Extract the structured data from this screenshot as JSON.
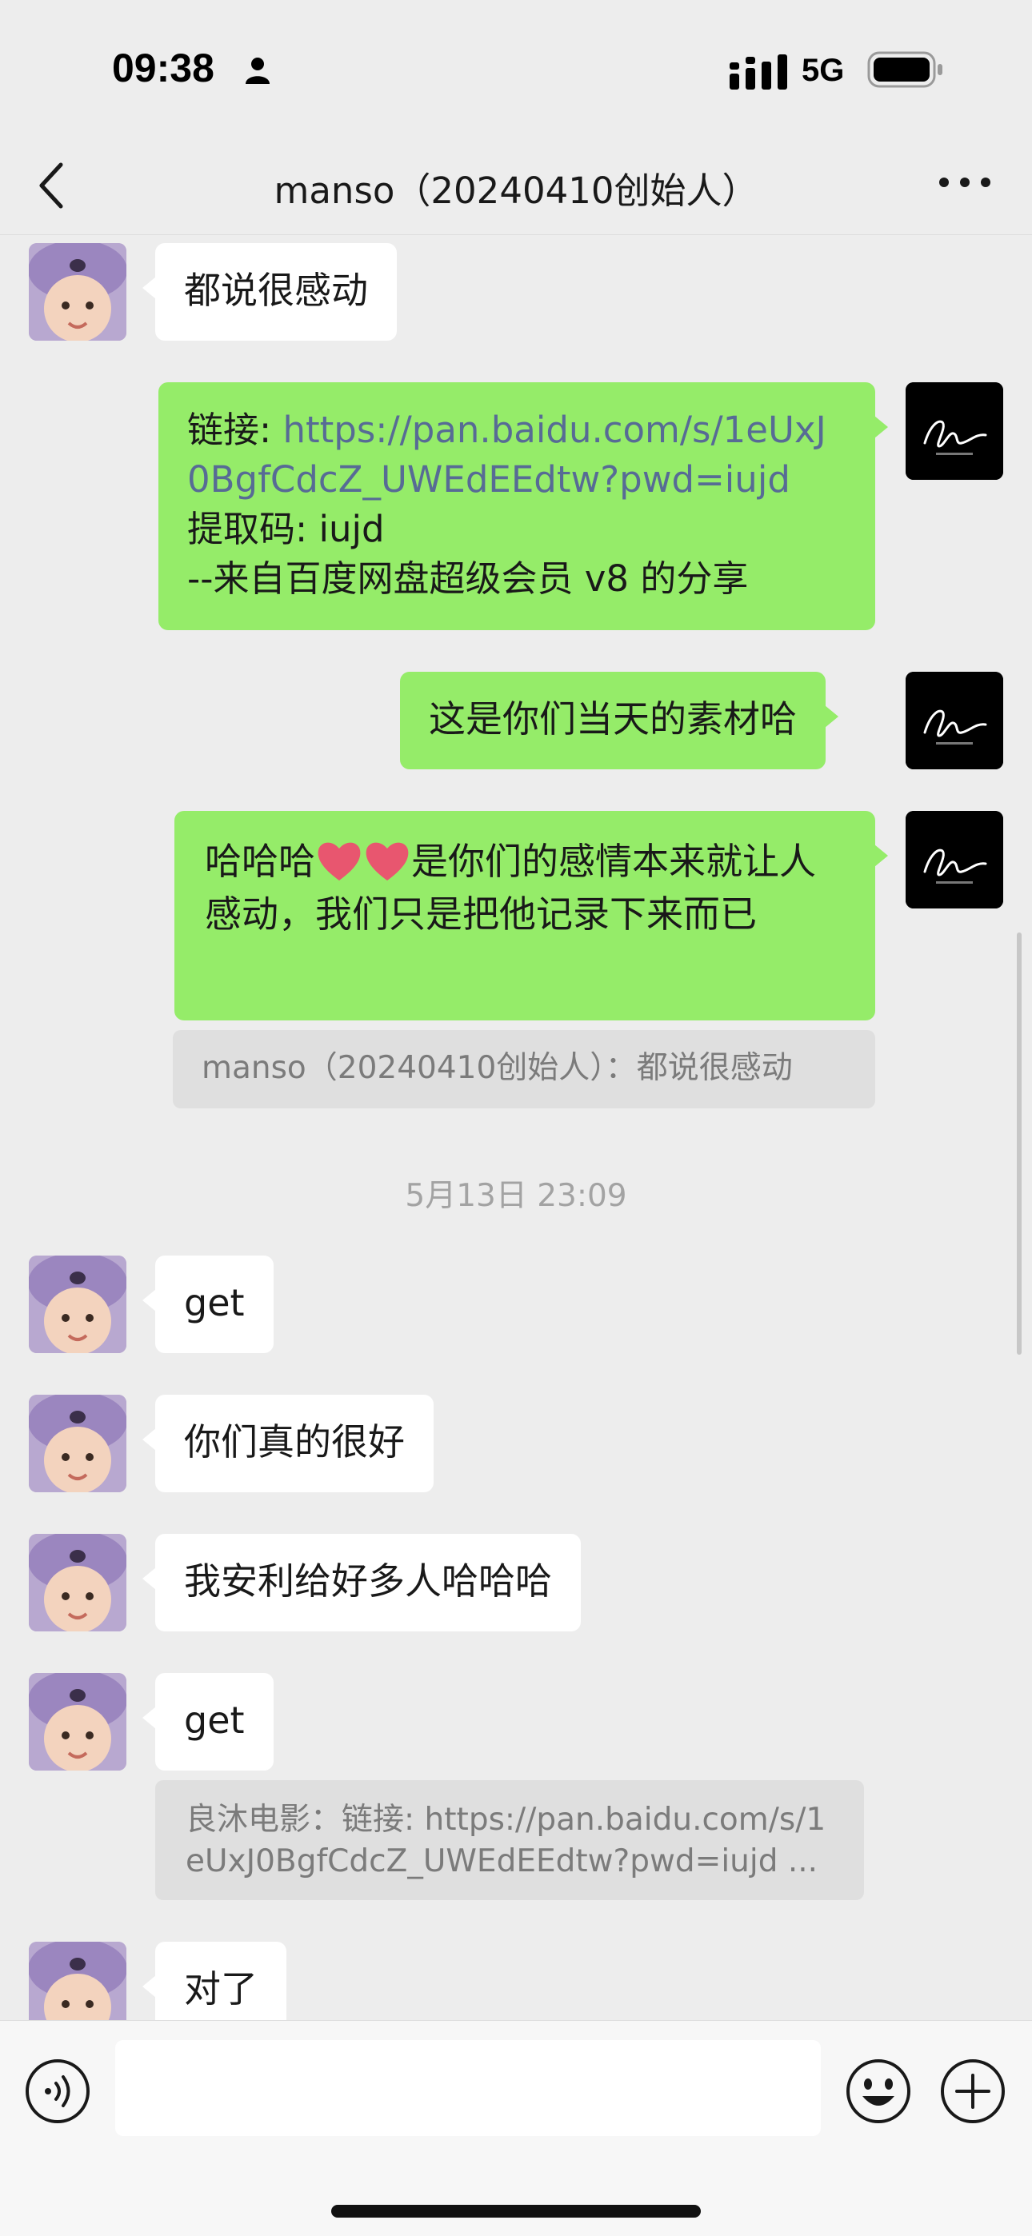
{
  "status_bar": {
    "time": "09:38",
    "network": "5G",
    "icons": [
      "person-icon",
      "signal-icon",
      "battery-icon"
    ]
  },
  "nav": {
    "title": "manso（20240410创始人）",
    "back_icon": "chevron-left-icon",
    "more_icon": "more-dots-icon"
  },
  "messages": [
    {
      "side": "in",
      "text": "都说很感动"
    },
    {
      "side": "out",
      "prefix": "链接: ",
      "link": "https://pan.baidu.com/s/1eUxJ0BgfCdcZ_UWEdEEdtw?pwd=iujd",
      "line2": "提取码: iujd",
      "line3": "--来自百度网盘超级会员 v8 的分享"
    },
    {
      "side": "out",
      "text": "这是你们当天的素材哈"
    },
    {
      "side": "out",
      "text_before": "哈哈哈",
      "text_after": "是你们的感情本来就让人感动，我们只是把他记录下来而已",
      "emoji": [
        "heart-icon",
        "heart-icon"
      ]
    },
    {
      "side": "quote",
      "text": "manso（20240410创始人）：都说很感动"
    },
    {
      "side": "in",
      "text": "get"
    },
    {
      "side": "in",
      "text": "你们真的很好"
    },
    {
      "side": "in",
      "text": "我安利给好多人哈哈哈"
    },
    {
      "side": "in",
      "text": "get"
    },
    {
      "side": "quote",
      "line1": "良沐电影：链接: https://pan.baidu.com/s/1",
      "line2": "eUxJ0BgfCdcZ_UWEdEEdtw?pwd=iujd ..."
    },
    {
      "side": "in",
      "text": "对了"
    }
  ],
  "timestamp": "5月13日 23:09",
  "input_bar": {
    "placeholder": "",
    "icons": [
      "voice-icon",
      "emoji-icon",
      "plus-icon"
    ]
  },
  "colors": {
    "background": "#ededed",
    "outgoing_bubble": "#95ec69",
    "incoming_bubble": "#ffffff",
    "link": "#576b95"
  }
}
